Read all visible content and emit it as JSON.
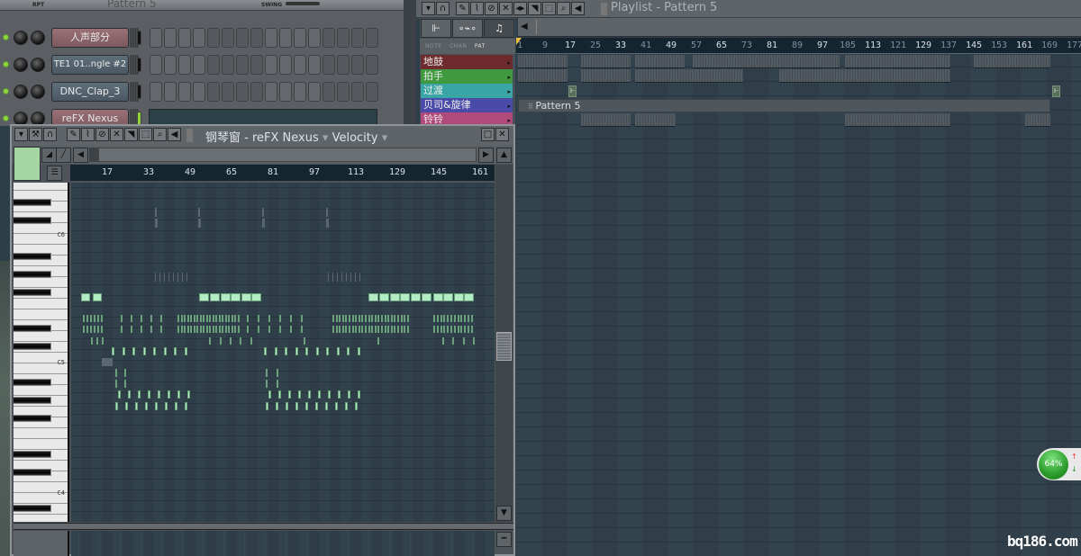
{
  "channel_rack": {
    "top_labels": {
      "rpt": "RPT",
      "pattern": "Pattern 5",
      "swing": "SWING"
    },
    "channels": [
      {
        "name": "人声部分",
        "style": "pink"
      },
      {
        "name": "TE1 01..ngle #2",
        "style": "gray"
      },
      {
        "name": "DNC_Clap_3",
        "style": "gray"
      },
      {
        "name": "reFX Nexus",
        "style": "pink"
      }
    ]
  },
  "playlist": {
    "title": "Playlist - Pattern 5",
    "tabs": [
      "⊩",
      "∘⌁∘",
      "♫"
    ],
    "filter_labels": {
      "note": "NOTE",
      "chan": "CHAN",
      "pat": "PAT"
    },
    "tracks": [
      {
        "name": "地鼓",
        "color": "#6e2b2e"
      },
      {
        "name": "拍手",
        "color": "#3f9a3f"
      },
      {
        "name": "过渡",
        "color": "#3aa5a5"
      },
      {
        "name": "贝司&旋律",
        "color": "#4a4aa8"
      },
      {
        "name": "铃铃",
        "color": "#b04a7a"
      }
    ],
    "ruler": [
      "1",
      "9",
      "17",
      "25",
      "33",
      "41",
      "49",
      "57",
      "65",
      "73",
      "81",
      "89",
      "97",
      "105",
      "113",
      "121",
      "129",
      "137",
      "145",
      "153",
      "161",
      "169",
      "177"
    ],
    "pattern_clip_label": "Pattern 5"
  },
  "piano_roll": {
    "title_prefix": "钢琴窗",
    "instrument": "reFX Nexus",
    "mode": "Velocity",
    "ruler": [
      "17",
      "33",
      "49",
      "65",
      "81",
      "97",
      "113",
      "129",
      "145",
      "161"
    ],
    "key_labels": {
      "c6": "C6",
      "c5": "C5",
      "c4": "C4"
    }
  },
  "cpu_meter": {
    "value": "64%"
  },
  "watermark": "bq186.com"
}
